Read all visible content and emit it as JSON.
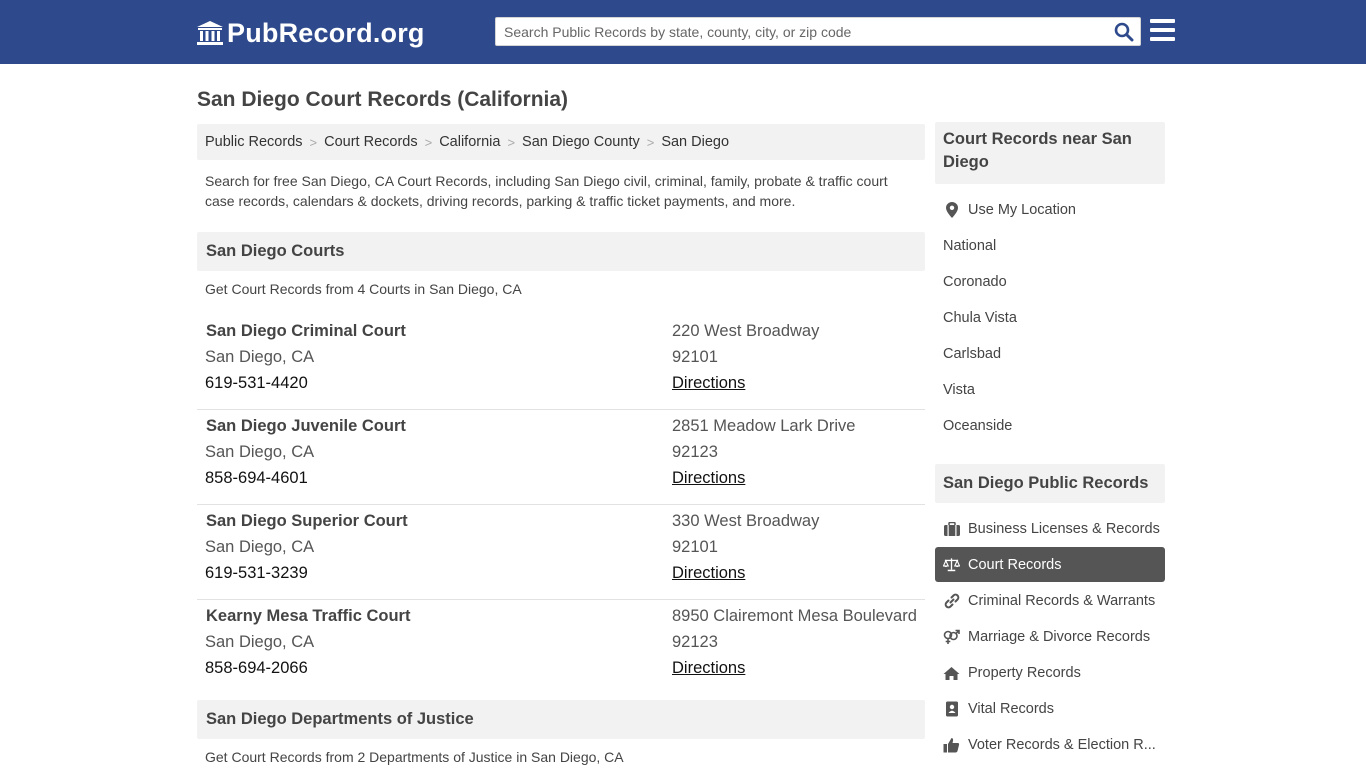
{
  "header": {
    "logo_text": "PubRecord.org",
    "search_placeholder": "Search Public Records by state, county, city, or zip code"
  },
  "page_title": "San Diego Court Records (California)",
  "breadcrumbs": [
    "Public Records",
    "Court Records",
    "California",
    "San Diego County",
    "San Diego"
  ],
  "intro": "Search for free San Diego, CA Court Records, including San Diego civil, criminal, family, probate & traffic court case records, calendars & dockets, driving records, parking & traffic ticket payments, and more.",
  "courts_section": {
    "heading": "San Diego Courts",
    "subtitle": "Get Court Records from 4 Courts in San Diego, CA",
    "items": [
      {
        "name": "San Diego Criminal Court",
        "city": "San Diego, CA",
        "phone": "619-531-4420",
        "address": "220 West Broadway",
        "zip": "92101",
        "directions": "Directions"
      },
      {
        "name": "San Diego Juvenile Court",
        "city": "San Diego, CA",
        "phone": "858-694-4601",
        "address": "2851 Meadow Lark Drive",
        "zip": "92123",
        "directions": "Directions"
      },
      {
        "name": "San Diego Superior Court",
        "city": "San Diego, CA",
        "phone": "619-531-3239",
        "address": "330 West Broadway",
        "zip": "92101",
        "directions": "Directions"
      },
      {
        "name": "Kearny Mesa Traffic Court",
        "city": "San Diego, CA",
        "phone": "858-694-2066",
        "address": "8950 Clairemont Mesa Boulevard",
        "zip": "92123",
        "directions": "Directions"
      }
    ]
  },
  "doj_section": {
    "heading": "San Diego Departments of Justice",
    "subtitle": "Get Court Records from 2 Departments of Justice in San Diego, CA"
  },
  "sidebar": {
    "near_heading": "Court Records near San Diego",
    "use_location": "Use My Location",
    "near_items": [
      "National",
      "Coronado",
      "Chula Vista",
      "Carlsbad",
      "Vista",
      "Oceanside"
    ],
    "public_heading": "San Diego Public Records",
    "public_items": [
      {
        "label": "Business Licenses & Records",
        "icon": "briefcase-icon"
      },
      {
        "label": "Court Records",
        "icon": "scale-icon",
        "active": true
      },
      {
        "label": "Criminal Records & Warrants",
        "icon": "link-icon"
      },
      {
        "label": "Marriage & Divorce Records",
        "icon": "gender-icon"
      },
      {
        "label": "Property Records",
        "icon": "home-icon"
      },
      {
        "label": "Vital Records",
        "icon": "address-book-icon"
      },
      {
        "label": "Voter Records & Election R...",
        "icon": "thumbs-up-icon"
      }
    ]
  },
  "colors": {
    "header_bg": "#2e4a8c",
    "panel_bg": "#f2f2f2",
    "active_bg": "#555555"
  }
}
